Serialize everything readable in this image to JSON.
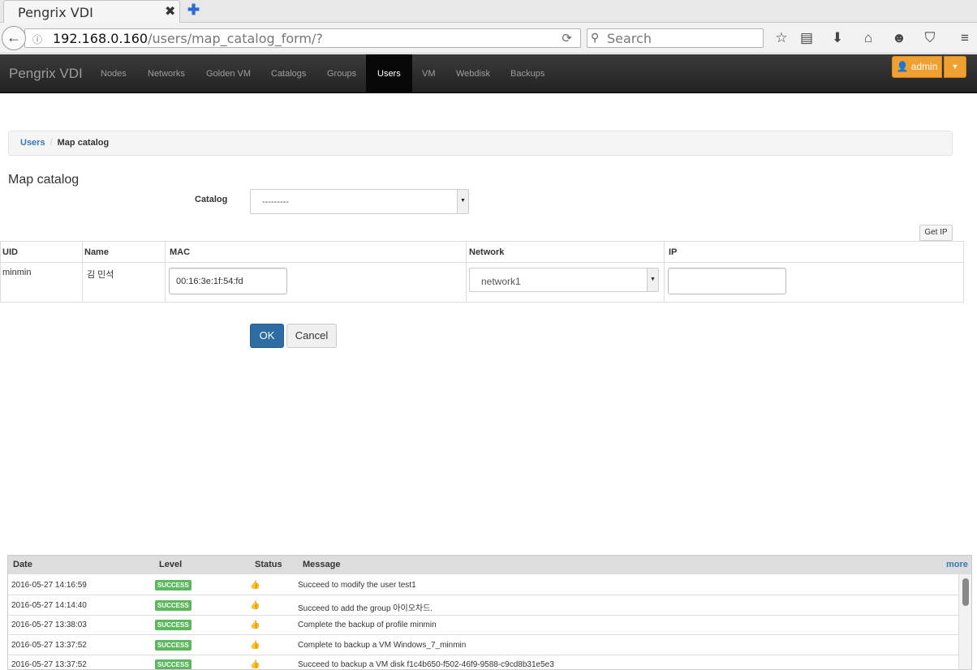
{
  "browser": {
    "tab_title": "Pengrix VDI",
    "tab_close": "✖",
    "new_tab": "✚",
    "url_host": "192.168.0.160",
    "url_path": "/users/map_catalog_form/?",
    "search_placeholder": "Search"
  },
  "app": {
    "brand": "Pengrix VDI",
    "nav": [
      "Nodes",
      "Networks",
      "Golden VM",
      "Catalogs",
      "Groups",
      "Users",
      "VM",
      "Webdisk",
      "Backups"
    ],
    "active_nav": "Users",
    "admin_label": "admin"
  },
  "breadcrumb": {
    "link": "Users",
    "separator": "/",
    "current": "Map catalog"
  },
  "form": {
    "title": "Map catalog",
    "catalog_label": "Catalog",
    "catalog_value": "---------",
    "get_ip_label": "Get IP",
    "columns": [
      "UID",
      "Name",
      "MAC",
      "Network",
      "IP"
    ],
    "row": {
      "uid": "minmin",
      "name": "김 민석",
      "mac": "00:16:3e:1f:54:fd",
      "network": "network1",
      "ip": ""
    },
    "ok_label": "OK",
    "cancel_label": "Cancel"
  },
  "log": {
    "headers": {
      "date": "Date",
      "level": "Level",
      "status": "Status",
      "message": "Message",
      "more": "more"
    },
    "rows": [
      {
        "date": "2016-05-27 14:16:59",
        "level": "SUCCESS",
        "status": "👍",
        "message": "Succeed to modify the user test1"
      },
      {
        "date": "2016-05-27 14:14:40",
        "level": "SUCCESS",
        "status": "👍",
        "message": "Succeed to add the group 아이오차드."
      },
      {
        "date": "2016-05-27 13:38:03",
        "level": "SUCCESS",
        "status": "👍",
        "message": "Complete the backup of profile minmin"
      },
      {
        "date": "2016-05-27 13:37:52",
        "level": "SUCCESS",
        "status": "👍",
        "message": "Complete to backup a VM Windows_7_minmin"
      },
      {
        "date": "2016-05-27 13:37:52",
        "level": "SUCCESS",
        "status": "👍",
        "message": "Succeed to backup a VM disk f1c4b650-f502-46f9-9588-c9cd8b31e5e3"
      }
    ],
    "success_color": "#5cb85c"
  },
  "colors": {
    "primary": "#2e6da4",
    "warning": "#f0a030",
    "link": "#337ab7"
  }
}
